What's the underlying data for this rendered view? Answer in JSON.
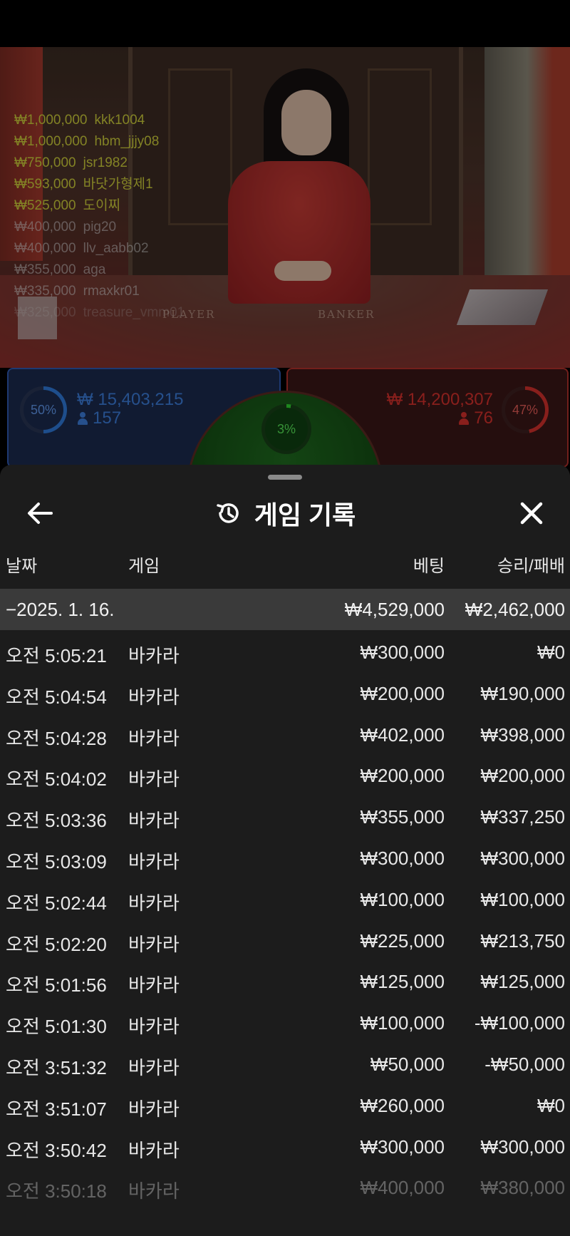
{
  "video": {
    "table_labels": {
      "player": "PLAYER",
      "banker": "BANKER"
    },
    "bets_feed": [
      {
        "amount": "₩1,000,000",
        "user": "kkk1004",
        "style": "highlight"
      },
      {
        "amount": "₩1,000,000",
        "user": "hbm_jjjy08",
        "style": "highlight"
      },
      {
        "amount": "₩750,000",
        "user": "jsr1982",
        "style": "highlight"
      },
      {
        "amount": "₩593,000",
        "user": "바닷가형제1",
        "style": "highlight"
      },
      {
        "amount": "₩525,000",
        "user": "도이찌",
        "style": "highlight"
      },
      {
        "amount": "₩400,000",
        "user": "pig20",
        "style": "dim"
      },
      {
        "amount": "₩400,000",
        "user": "llv_aabb02",
        "style": "dim"
      },
      {
        "amount": "₩355,000",
        "user": "aga",
        "style": "dim"
      },
      {
        "amount": "₩335,000",
        "user": "rmaxkr01",
        "style": "dim"
      },
      {
        "amount": "₩325,000",
        "user": "treasure_vmm01",
        "style": "faint"
      }
    ]
  },
  "betting": {
    "player": {
      "percent": "50%",
      "amount": "₩ 15,403,215",
      "count": "157",
      "color": "#2f79d8"
    },
    "banker": {
      "percent": "47%",
      "amount": "₩ 14,200,307",
      "count": "76",
      "color": "#d2302c"
    },
    "tie": {
      "percent": "3%",
      "color": "#2fd02f"
    }
  },
  "sheet": {
    "title": "게임 기록",
    "icons": {
      "back": "arrow-left-icon",
      "history": "history-icon",
      "close": "close-icon"
    },
    "columns": {
      "date": "날짜",
      "game": "게임",
      "bet": "베팅",
      "win_loss": "승리/패배"
    },
    "group": {
      "label": "−2025. 1. 16.",
      "bet_total": "₩4,529,000",
      "win_total": "₩2,462,000"
    },
    "rows": [
      {
        "time": "오전 5:05:21",
        "game": "바카라",
        "bet": "₩300,000",
        "result": "₩0"
      },
      {
        "time": "오전 5:04:54",
        "game": "바카라",
        "bet": "₩200,000",
        "result": "₩190,000"
      },
      {
        "time": "오전 5:04:28",
        "game": "바카라",
        "bet": "₩402,000",
        "result": "₩398,000"
      },
      {
        "time": "오전 5:04:02",
        "game": "바카라",
        "bet": "₩200,000",
        "result": "₩200,000"
      },
      {
        "time": "오전 5:03:36",
        "game": "바카라",
        "bet": "₩355,000",
        "result": "₩337,250"
      },
      {
        "time": "오전 5:03:09",
        "game": "바카라",
        "bet": "₩300,000",
        "result": "₩300,000"
      },
      {
        "time": "오전 5:02:44",
        "game": "바카라",
        "bet": "₩100,000",
        "result": "₩100,000"
      },
      {
        "time": "오전 5:02:20",
        "game": "바카라",
        "bet": "₩225,000",
        "result": "₩213,750"
      },
      {
        "time": "오전 5:01:56",
        "game": "바카라",
        "bet": "₩125,000",
        "result": "₩125,000"
      },
      {
        "time": "오전 5:01:30",
        "game": "바카라",
        "bet": "₩100,000",
        "result": "-₩100,000"
      },
      {
        "time": "오전 3:51:32",
        "game": "바카라",
        "bet": "₩50,000",
        "result": "-₩50,000"
      },
      {
        "time": "오전 3:51:07",
        "game": "바카라",
        "bet": "₩260,000",
        "result": "₩0"
      },
      {
        "time": "오전 3:50:42",
        "game": "바카라",
        "bet": "₩300,000",
        "result": "₩300,000"
      },
      {
        "time": "오전 3:50:18",
        "game": "바카라",
        "bet": "₩400,000",
        "result": "₩380,000"
      }
    ]
  }
}
